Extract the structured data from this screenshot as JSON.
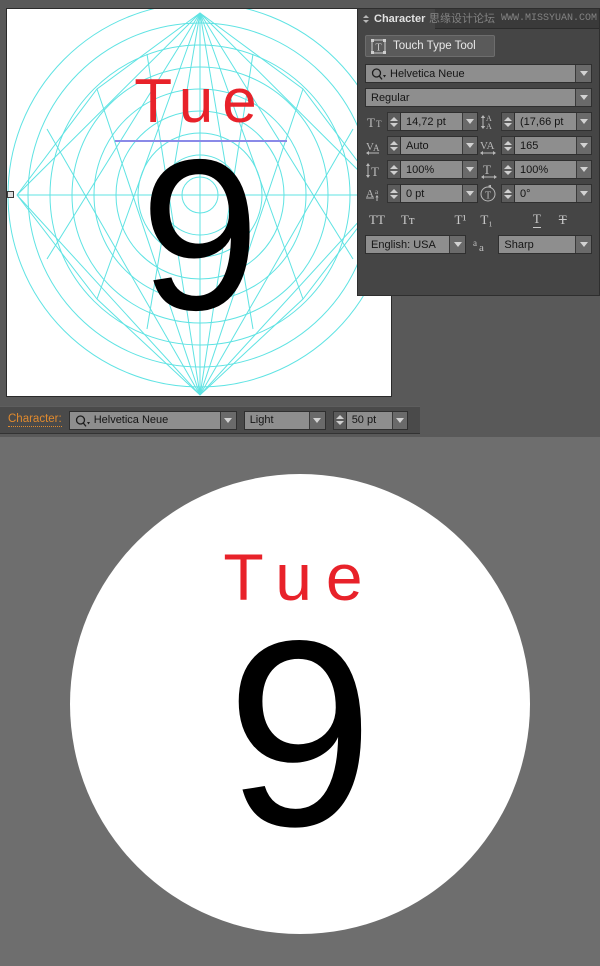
{
  "app": {
    "background_color": "#666666",
    "canvas_color": "#ffffff",
    "panel_color": "#454545",
    "accent_color": "#e08a2e",
    "grid_color": "#4ee0e0",
    "text_red": "#e8222a",
    "baseline_color": "#8a8ae8"
  },
  "watermark": {
    "chinese": "思缘设计论坛",
    "url": "WWW.MISSYUAN.COM"
  },
  "artboard": {
    "day_label": "Tue",
    "date_number": "9"
  },
  "character_panel": {
    "tab_label": "Character",
    "touch_type_tool": "Touch Type Tool",
    "font_family": "Helvetica Neue",
    "font_style": "Regular",
    "font_size": "14,72 pt",
    "leading": "(17,66 pt",
    "kerning": "Auto",
    "tracking": "165",
    "vertical_scale": "100%",
    "horizontal_scale": "100%",
    "baseline_shift": "0 pt",
    "rotation": "0°",
    "language": "English: USA",
    "anti_aliasing": "Sharp",
    "style_buttons": [
      {
        "name": "all-caps",
        "glyph": "TT"
      },
      {
        "name": "small-caps",
        "glyph": "Tᴛ"
      },
      {
        "name": "superscript",
        "glyph": "T¹"
      },
      {
        "name": "subscript",
        "glyph": "T₁"
      },
      {
        "name": "underline",
        "glyph": "T"
      },
      {
        "name": "strikethrough",
        "glyph": "T"
      }
    ],
    "icons": {
      "font_size": "font-size-icon",
      "leading": "leading-icon",
      "kerning": "kerning-icon",
      "tracking": "tracking-icon",
      "vertical_scale": "vertical-scale-icon",
      "horizontal_scale": "horizontal-scale-icon",
      "baseline_shift": "baseline-shift-icon",
      "rotation": "character-rotation-icon",
      "anti_aliasing": "anti-aliasing-icon"
    }
  },
  "control_bar": {
    "label": "Character:",
    "font_family": "Helvetica Neue",
    "font_style": "Light",
    "font_size": "50 pt"
  },
  "preview": {
    "day_label": "Tue",
    "date_number": "9"
  }
}
